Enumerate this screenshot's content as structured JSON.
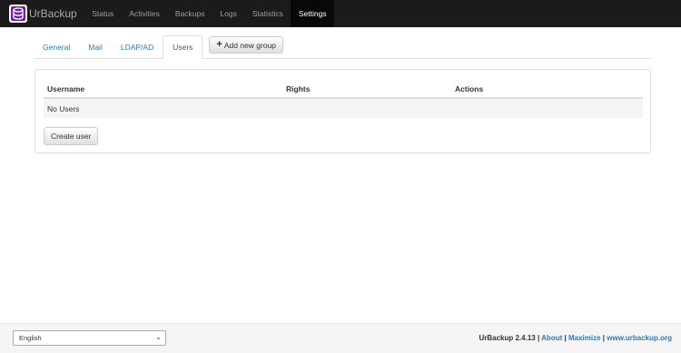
{
  "brand": {
    "name": "UrBackup"
  },
  "nav": {
    "items": [
      {
        "label": "Status"
      },
      {
        "label": "Activities"
      },
      {
        "label": "Backups"
      },
      {
        "label": "Logs"
      },
      {
        "label": "Statistics"
      },
      {
        "label": "Settings",
        "active": true
      }
    ]
  },
  "tabs": {
    "items": [
      {
        "label": "General"
      },
      {
        "label": "Mail"
      },
      {
        "label": "LDAP/AD"
      },
      {
        "label": "Users",
        "active": true
      }
    ],
    "add_group_label": "Add new group"
  },
  "users_table": {
    "headers": [
      "Username",
      "Rights",
      "Actions"
    ],
    "empty_text": "No Users",
    "create_label": "Create user"
  },
  "footer": {
    "language": "English",
    "version": "UrBackup 2.4.13",
    "sep": "|",
    "about": "About",
    "maximize": "Maximize",
    "site": "www.urbackup.org"
  },
  "colors": {
    "navbar": "#1b1b1b",
    "link": "#337ab7",
    "active_nav": "#080808"
  }
}
